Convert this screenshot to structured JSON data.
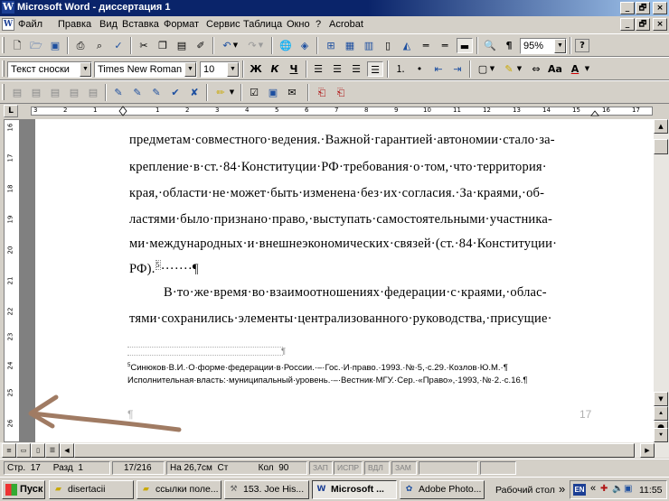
{
  "window": {
    "title": "Microsoft Word - диссертация 1",
    "controls": [
      "_",
      "🗗",
      "×"
    ]
  },
  "menu": {
    "items": [
      "Файл",
      "Правка",
      "Вид",
      "Вставка",
      "Формат",
      "Сервис",
      "Таблица",
      "Окно",
      "?",
      "Acrobat"
    ],
    "doc_controls": [
      "_",
      "🗗",
      "×"
    ]
  },
  "toolbar_standard": {
    "zoom": "95%",
    "pilcrow": "¶"
  },
  "toolbar_formatting": {
    "style": "Текст сноски",
    "font": "Times New Roman",
    "size": "10",
    "bold": "Ж",
    "italic": "К",
    "underline": "Ч",
    "change_case": "Aa"
  },
  "ruler": {
    "h_numbers": [
      "3",
      "2",
      "1",
      "1",
      "2",
      "3",
      "4",
      "5",
      "6",
      "7",
      "8",
      "9",
      "10",
      "11",
      "12",
      "13",
      "14",
      "15",
      "16",
      "17"
    ],
    "v_numbers": [
      "16",
      "17",
      "18",
      "19",
      "20",
      "21",
      "22",
      "23",
      "24",
      "25",
      "26"
    ],
    "tab_selector": "L"
  },
  "document": {
    "lines": [
      "предметам·совместного·ведения.·Важной·гарантией·автономии·стало·за-",
      "крепление·в·ст.·84·Конституции·РФ·требования·о·том,·что·территория·",
      "края,·области·не·может·быть·изменена·без·их·согласия.·За·краями,·об-",
      "ластями·было·признано·право,·выступать·самостоятельными·участника-",
      "ми·международных·и·внешнеэкономических·связей·(ст.·84·Конституции·",
      "РФ).",
      "В·то·же·время·во·взаимоотношениях·федерации·с·краями,·облас-",
      "тями·сохранились·элементы·централизованного·руководства,·присущие·"
    ],
    "footnote_marker": "5",
    "footnote_tail": "·······¶",
    "footnote_lines": [
      "Синюков·В.И.·О·форме·федерации·в·России.·–·Гос.·И·право.·1993.·№·5,·с.29.·Козлов·Ю.М.·¶",
      "Исполнительная·власть:·муниципальный·уровень.·–·Вестник·МГУ.·Сер.·«Право»,·1993,·№·2.·с.16.¶"
    ],
    "footnote_separator_mark": "¶",
    "footer_mark": "¶",
    "page_number": "17"
  },
  "statusbar": {
    "page": "Стр.",
    "page_value": "17",
    "section": "Разд",
    "section_value": "1",
    "pages": "17/216",
    "position": "На 26,7см",
    "line": "Ст",
    "column": "Кол",
    "column_value": "90",
    "modes": [
      "ЗАП",
      "ИСПР",
      "ВДЛ",
      "ЗАМ"
    ]
  },
  "taskbar": {
    "start": "Пуск",
    "tasks": [
      "disertacii",
      "ссылки поле...",
      "153. Joe His...",
      "Microsoft ...",
      "Adobe Photo..."
    ],
    "desktop": "Рабочий стол",
    "chevron": "»",
    "lang": "EN",
    "clock": "11:55"
  },
  "colors": {
    "title_bar": "#0a246a",
    "chrome": "#d4d0c8",
    "annotation_arrow": "#a07b63"
  }
}
